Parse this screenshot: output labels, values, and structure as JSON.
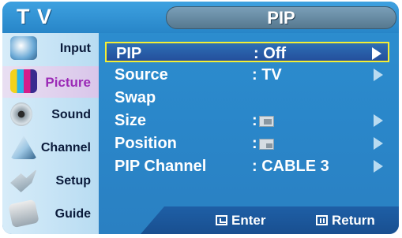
{
  "top": {
    "brand": "T V",
    "menu_title": "PIP"
  },
  "sidebar": {
    "items": [
      {
        "label": "Input",
        "icon": "input-icon"
      },
      {
        "label": "Picture",
        "icon": "picture-icon",
        "selected": true
      },
      {
        "label": "Sound",
        "icon": "sound-icon"
      },
      {
        "label": "Channel",
        "icon": "channel-icon"
      },
      {
        "label": "Setup",
        "icon": "setup-icon"
      },
      {
        "label": "Guide",
        "icon": "guide-icon"
      }
    ]
  },
  "menu": {
    "rows": [
      {
        "label": "PIP",
        "value": ": Off",
        "arrow": true,
        "selected": true
      },
      {
        "label": "Source",
        "value": ": TV",
        "arrow": true
      },
      {
        "label": "Swap",
        "value": "",
        "arrow": false
      },
      {
        "label": "Size",
        "value": ":",
        "arrow": true,
        "thumbnail": "size"
      },
      {
        "label": "Position",
        "value": ":",
        "arrow": true,
        "thumbnail": "position"
      },
      {
        "label": "PIP Channel",
        "value": ": CABLE 3",
        "arrow": true
      }
    ]
  },
  "footer": {
    "enter": "Enter",
    "return": "Return"
  },
  "colors": {
    "accent": "#2a86c9",
    "selection": "#f4ee34",
    "selected_label": "#9b2ab6"
  }
}
